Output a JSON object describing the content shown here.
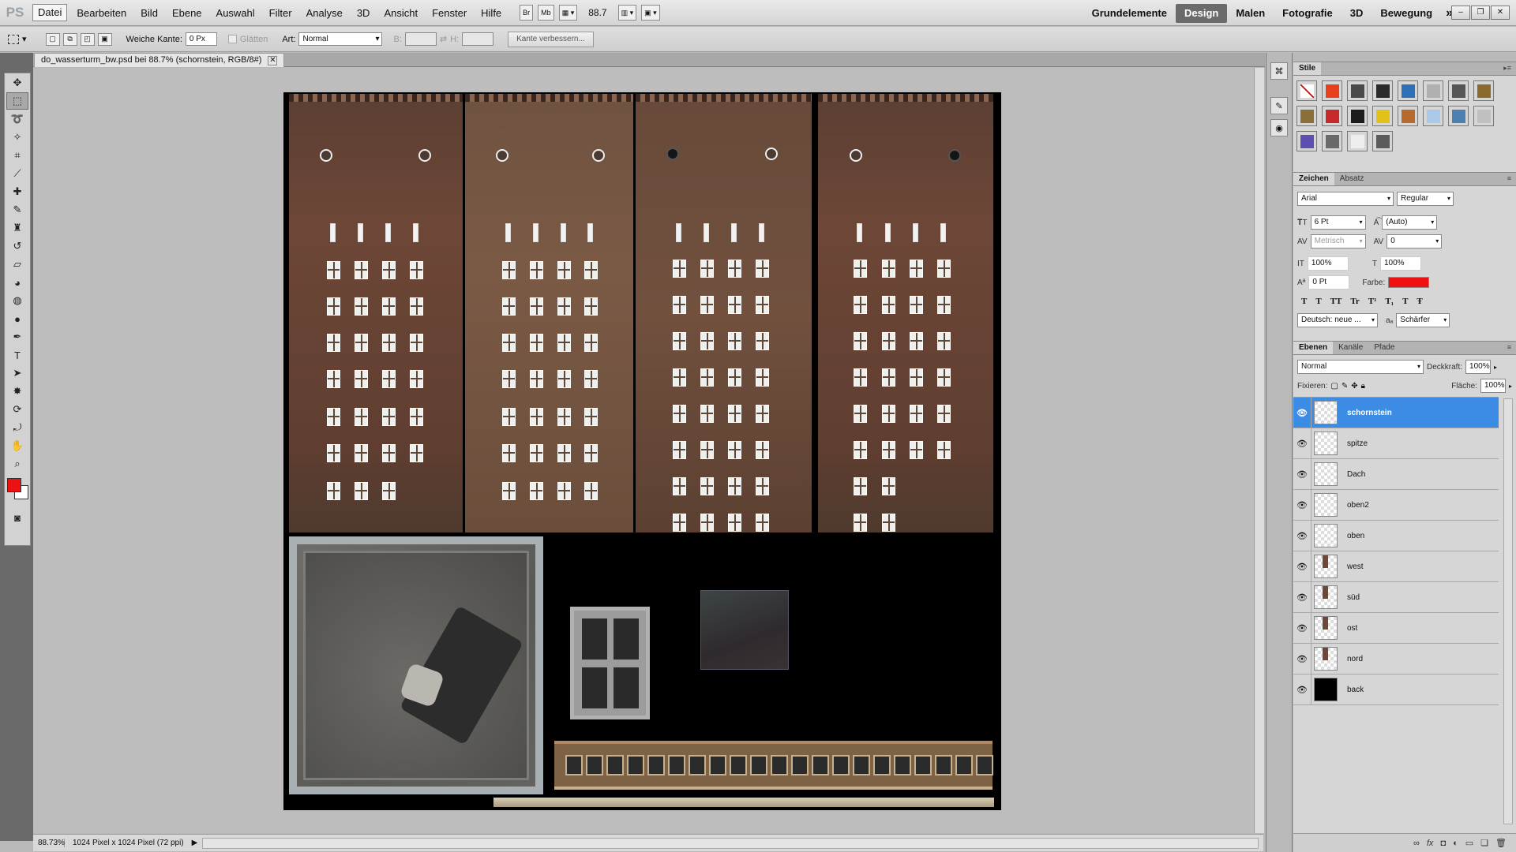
{
  "app": {
    "logo": "PS"
  },
  "menu": [
    "Datei",
    "Bearbeiten",
    "Bild",
    "Ebene",
    "Auswahl",
    "Filter",
    "Analyse",
    "3D",
    "Ansicht",
    "Fenster",
    "Hilfe"
  ],
  "toolbar": {
    "br": "Br",
    "mb": "Mb",
    "zoom": "88.7"
  },
  "workspaces": [
    "Grundelemente",
    "Design",
    "Malen",
    "Fotografie",
    "3D",
    "Bewegung"
  ],
  "workspace_more": "»",
  "options": {
    "feather_label": "Weiche Kante:",
    "feather_value": "0 Px",
    "antialias": "Glätten",
    "style_label": "Art:",
    "style_value": "Normal",
    "width_label": "B:",
    "height_label": "H:",
    "refine_button": "Kante verbessern..."
  },
  "document": {
    "tab_title": "do_wasserturm_bw.psd bei 88.7% (schornstein, RGB/8#)"
  },
  "status": {
    "zoom": "88.73%",
    "info": "1024 Pixel x 1024 Pixel (72 ppi)"
  },
  "styles_panel": {
    "title": "Stile",
    "swatches": [
      "#ffffff",
      "#e8401c",
      "#4a4a4a",
      "#2b2b2b",
      "#2f6fb5",
      "#b0b0b0",
      "#555555",
      "#8a6b2d",
      "#8a6f3a",
      "#c72a2a",
      "#1d1d1d",
      "#e0c21a",
      "#b86a2c",
      "#a9c9e8",
      "#4d7fb0",
      "#c0c0c0",
      "#5c4fb0",
      "#6a6a6a",
      "#eeeeee",
      "#5a5a5a"
    ]
  },
  "char_panel": {
    "tabs": [
      "Zeichen",
      "Absatz"
    ],
    "font": "Arial",
    "style": "Regular",
    "size": "6 Pt",
    "leading": "(Auto)",
    "kerning": "Metrisch",
    "tracking": "0",
    "vscale": "100%",
    "hscale": "100%",
    "baseline": "0 Pt",
    "color_label": "Farbe:",
    "color": "#ee1111",
    "language": "Deutsch: neue ...",
    "aa_label": "aₐ",
    "antialias": "Schärfer",
    "glyphs": [
      "T",
      "T",
      "TT",
      "Tr",
      "T¹",
      "T₁",
      "T",
      "Ŧ"
    ]
  },
  "layers_panel": {
    "tabs": [
      "Ebenen",
      "Kanäle",
      "Pfade"
    ],
    "mode": "Normal",
    "opacity_label": "Deckkraft:",
    "opacity": "100%",
    "lock_label": "Fixieren:",
    "fill_label": "Fläche:",
    "fill": "100%",
    "layers": [
      {
        "name": "schornstein",
        "selected": true
      },
      {
        "name": "spitze"
      },
      {
        "name": "Dach"
      },
      {
        "name": "oben2"
      },
      {
        "name": "oben"
      },
      {
        "name": "west"
      },
      {
        "name": "süd"
      },
      {
        "name": "ost"
      },
      {
        "name": "nord"
      },
      {
        "name": "back"
      }
    ]
  }
}
